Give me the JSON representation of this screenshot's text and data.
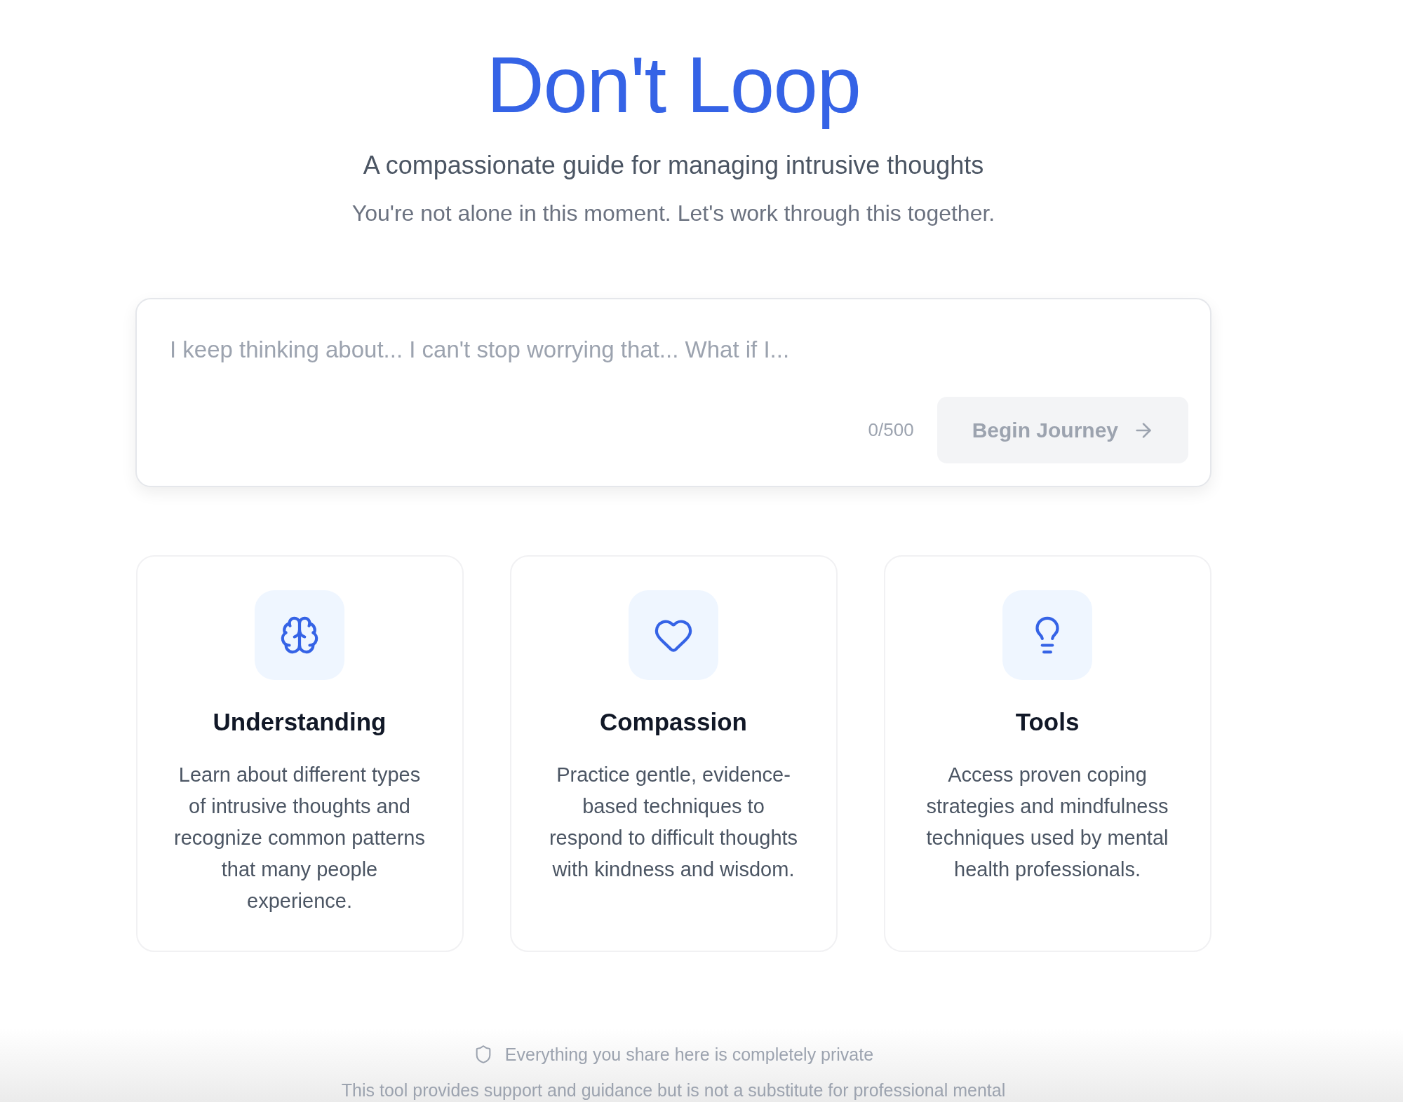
{
  "header": {
    "title": "Don't Loop",
    "tagline": "A compassionate guide for managing intrusive thoughts",
    "reassurance": "You're not alone in this moment. Let's work through this together."
  },
  "thought_input": {
    "placeholder": "I keep thinking about... I can't stop worrying that... What if I...",
    "counter": "0/500",
    "submit_button": {
      "label": "Begin Journey",
      "disabled": true
    }
  },
  "features": [
    {
      "kind": "brain",
      "title": "Understanding",
      "description": "Learn about different types of intrusive thoughts and recognize common patterns that many people experience."
    },
    {
      "kind": "heart",
      "title": "Compassion",
      "description": "Practice gentle, evidence-based techniques to respond to difficult thoughts with kindness and wisdom."
    },
    {
      "kind": "bulb",
      "title": "Tools",
      "description": "Access proven coping strategies and mindfulness techniques used by mental health professionals."
    }
  ],
  "footer": {
    "privacy_note": "Everything you share here is completely private",
    "disclaimer": "This tool provides support and guidance but is not a substitute for professional mental"
  }
}
